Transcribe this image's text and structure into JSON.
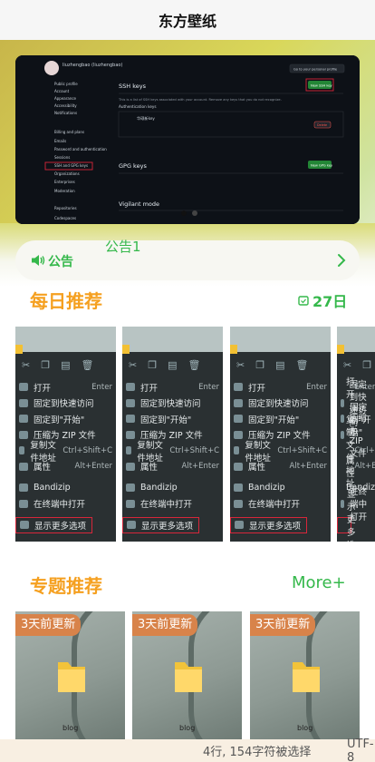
{
  "app": {
    "title": "东方壁纸"
  },
  "banner": {
    "screenshot": {
      "username": "liuzhengbao (liuzhengbao)",
      "profile_link": "Go to your personal profile",
      "sidebar": [
        "Public profile",
        "Account",
        "Appearance",
        "Accessibility",
        "Notifications",
        "Billing and plans",
        "Emails",
        "Password and authentication",
        "Sessions",
        "SSH and GPG keys",
        "Organizations",
        "Enterprises",
        "Moderation",
        "Repositories",
        "Codespaces"
      ],
      "ssh_title": "SSH keys",
      "new_ssh_button": "New SSH key",
      "ssh_desc": "This is a list of SSH keys associated with your account. Remove any keys that you do not recognize.",
      "auth_keys": "Authentication keys",
      "key_name": "华硕新key",
      "delete_button": "Delete",
      "gpg_title": "GPG keys",
      "new_gpg_button": "New GPG key",
      "vigilant_title": "Vigilant mode"
    },
    "dots": 2
  },
  "notice": {
    "label": "公告",
    "text": "公告1"
  },
  "daily": {
    "title": "每日推荐",
    "date": "27日"
  },
  "context_menu": {
    "items": [
      {
        "label": "打开",
        "shortcut": "Enter"
      },
      {
        "label": "固定到快速访问",
        "shortcut": ""
      },
      {
        "label": "固定到\"开始\"",
        "shortcut": ""
      },
      {
        "label": "压缩为 ZIP 文件",
        "shortcut": ""
      },
      {
        "label": "复制文件地址",
        "shortcut": "Ctrl+Shift+C"
      },
      {
        "label": "属性",
        "shortcut": "Alt+Enter"
      },
      {
        "label": "Bandizip",
        "shortcut": ""
      },
      {
        "label": "在终端中打开",
        "shortcut": ""
      },
      {
        "label": "显示更多选项",
        "shortcut": ""
      }
    ]
  },
  "topics": {
    "title": "专题推荐",
    "more": "More+",
    "tag": "3天前更新",
    "caption": "blog"
  },
  "statusbar": {
    "selection": "4行, 154字符被选择",
    "encoding": "UTF-8"
  },
  "colors": {
    "accent_green": "#35b84b",
    "accent_orange": "#f5a020",
    "tag_orange": "#d8834a"
  }
}
